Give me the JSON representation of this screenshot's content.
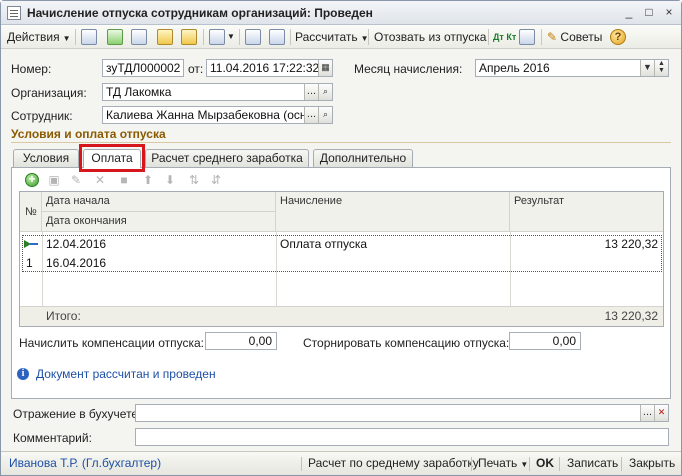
{
  "window": {
    "title": "Начисление отпуска сотрудникам организаций: Проведен",
    "controls": [
      "_",
      "□",
      "×"
    ]
  },
  "toolbar": {
    "actions_label": "Действия",
    "calculate_label": "Рассчитать",
    "recall_label": "Отозвать из отпуска",
    "dtkt_label": "Дт Кт",
    "tips_label": "Советы",
    "help_label": "?"
  },
  "form": {
    "number_label": "Номер:",
    "number_value": "зуТДЛ000002",
    "date_label": "от:",
    "date_value": "11.04.2016 17:22:32",
    "month_label": "Месяц начисления:",
    "month_value": "Апрель 2016",
    "org_label": "Организация:",
    "org_value": "ТД Лакомка",
    "employee_label": "Сотрудник:",
    "employee_value": "Калиева Жанна Мырзабековна  (осн.)",
    "ellipsis": "...",
    "section_title": "Условия и оплата отпуска"
  },
  "tabs": [
    {
      "label": "Условия"
    },
    {
      "label": "Оплата"
    },
    {
      "label": "Расчет среднего заработка"
    },
    {
      "label": "Дополнительно"
    }
  ],
  "grid": {
    "headers": {
      "num": "№",
      "start": "Дата начала",
      "end": "Дата окончания",
      "accrual": "Начисление",
      "result": "Результат"
    },
    "rows": [
      {
        "num": "1",
        "start": "12.04.2016",
        "end": "16.04.2016",
        "accrual": "Оплата отпуска",
        "result": "13 220,32"
      }
    ],
    "total_label": "Итого:",
    "total_value": "13 220,32"
  },
  "compensation": {
    "accrue_label": "Начислить компенсации отпуска:",
    "accrue_value": "0,00",
    "reverse_label": "Сторнировать компенсацию отпуска:",
    "reverse_value": "0,00"
  },
  "info": {
    "text": "Документ рассчитан и проведен"
  },
  "bottom_fields": {
    "accounting_label": "Отражение в бухучете:",
    "accounting_value": "",
    "comment_label": "Комментарий:",
    "comment_value": ""
  },
  "statusbar": {
    "user": "Иванова Т.Р. (Гл.бухгалтер)",
    "avg_salary_label": "Расчет по среднему заработку",
    "print_label": "Печать",
    "ok_label": "OK",
    "save_label": "Записать",
    "close_label": "Закрыть"
  },
  "colors": {
    "highlight": "#d6161d",
    "section_title": "#8a5a00",
    "link": "#1d4fa6"
  }
}
